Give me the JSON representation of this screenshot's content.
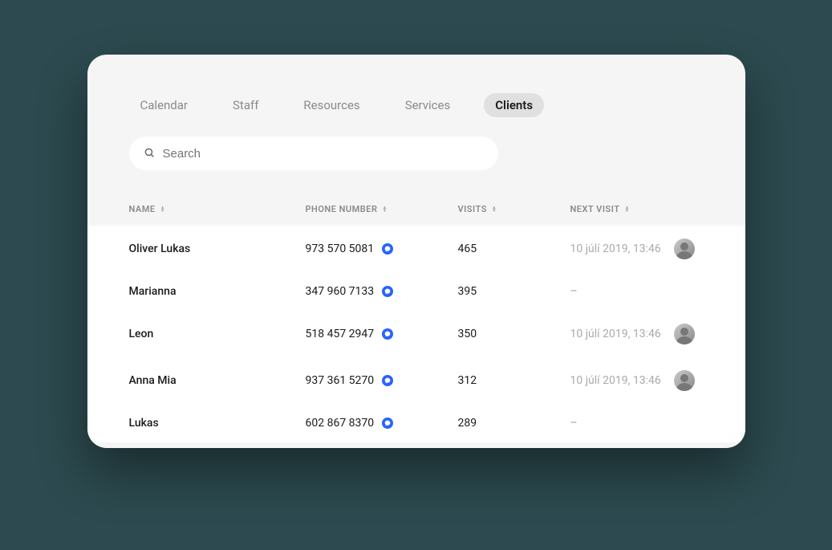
{
  "tabs": [
    {
      "label": "Calendar",
      "active": false
    },
    {
      "label": "Staff",
      "active": false
    },
    {
      "label": "Resources",
      "active": false
    },
    {
      "label": "Services",
      "active": false
    },
    {
      "label": "Clients",
      "active": true
    }
  ],
  "search": {
    "placeholder": "Search"
  },
  "columns": {
    "name": "NAME",
    "phone": "PHONE NUMBER",
    "visits": "VISITS",
    "next": "NEXT VISIT"
  },
  "rows": [
    {
      "name": "Oliver Lukas",
      "phone": "973 570 5081",
      "visits": "465",
      "next": "10 júlí 2019, 13:46",
      "hasAvatar": true
    },
    {
      "name": "Marianna",
      "phone": "347 960 7133",
      "visits": "395",
      "next": "–",
      "hasAvatar": false
    },
    {
      "name": "Leon",
      "phone": "518 457 2947",
      "visits": "350",
      "next": "10 júlí 2019, 13:46",
      "hasAvatar": true
    },
    {
      "name": "Anna Mia",
      "phone": "937 361 5270",
      "visits": "312",
      "next": "10 júlí 2019, 13:46",
      "hasAvatar": true
    },
    {
      "name": "Lukas",
      "phone": "602 867 8370",
      "visits": "289",
      "next": "–",
      "hasAvatar": false
    }
  ]
}
